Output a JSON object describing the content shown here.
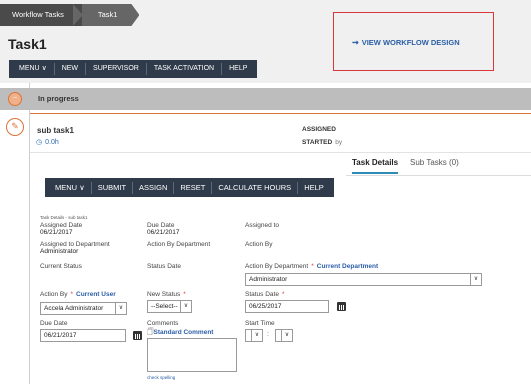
{
  "breadcrumb": {
    "first": "Workflow Tasks",
    "second": "Task1"
  },
  "page_title": "Task1",
  "top_menu": [
    "MENU",
    "NEW",
    "SUPERVISOR",
    "TASK ACTIVATION",
    "HELP"
  ],
  "view_design_label": "VIEW WORKFLOW DESIGN",
  "status_label": "In progress",
  "task": {
    "name": "sub task1",
    "time": "0.0h",
    "assigned_label": "ASSIGNED",
    "started_label": "STARTED",
    "started_by": "by"
  },
  "tabs": {
    "details": "Task Details",
    "subtasks": "Sub Tasks (0)"
  },
  "sub_menu": [
    "MENU",
    "SUBMIT",
    "ASSIGN",
    "RESET",
    "CALCULATE HOURS",
    "HELP"
  ],
  "details": {
    "caption": "Task Details - sub task1",
    "assigned_date_label": "Assigned Date",
    "assigned_date": "06/21/2017",
    "due_date_label": "Due Date",
    "due_date": "06/21/2017",
    "assigned_to_label": "Assigned to",
    "assigned_dept_label": "Assigned to Department",
    "assigned_dept": "Administrator",
    "action_by_dept_label": "Action By Department",
    "action_by_label": "Action By",
    "current_status_label": "Current Status",
    "status_date_label": "Status Date"
  },
  "form": {
    "action_by_dept_label": "Action By Department",
    "current_department_link": "Current Department",
    "action_by_dept_value": "Administrator",
    "action_by_label": "Action By",
    "current_user_link": "Current User",
    "action_by_value": "Accela Administrator",
    "new_status_label": "New Status",
    "new_status_value": "--Select--",
    "status_date_label": "Status Date",
    "status_date_value": "06/25/2017",
    "due_date_label": "Due Date",
    "due_date_value": "06/21/2017",
    "comments_label": "Comments",
    "standard_comment_link": "Standard Comment",
    "start_time_label": "Start Time",
    "start_time_separator": ":",
    "check_spelling": "check spelling",
    "required_marker": "*"
  }
}
